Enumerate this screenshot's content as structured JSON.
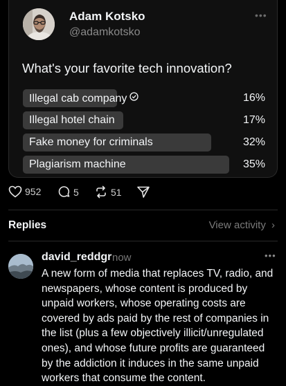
{
  "post": {
    "author_name": "Adam Kotsko",
    "author_handle": "@adamkotsko",
    "question": "What's your favorite tech innovation?",
    "poll": [
      {
        "label": "Illegal cab company",
        "percent_text": "16%",
        "percent": 16,
        "selected": true
      },
      {
        "label": "Illegal hotel chain",
        "percent_text": "17%",
        "percent": 17,
        "selected": false
      },
      {
        "label": "Fake money for criminals",
        "percent_text": "32%",
        "percent": 32,
        "selected": false
      },
      {
        "label": "Plagiarism machine",
        "percent_text": "35%",
        "percent": 35,
        "selected": false
      }
    ],
    "more_icon": "ellipsis-icon",
    "selected_icon": "check-circle-icon"
  },
  "actions": {
    "likes": "952",
    "comments": "5",
    "reposts": "51",
    "icons": [
      "heart-icon",
      "comment-icon",
      "repost-icon",
      "share-icon"
    ]
  },
  "replies_header": {
    "title": "Replies",
    "view_activity": "View activity",
    "chevron_icon": "chevron-right-icon"
  },
  "reply": {
    "username": "david_reddgr",
    "time": "now",
    "text": "A new form of media that replaces TV, radio, and newspapers, whose content is produced by unpaid workers, whose operating costs are covered by ads paid by the rest of companies in the list (plus a few objectively illicit/unregulated ones), and whose future profits are guaranteed by the addiction it induces in the same unpaid workers that consume the content."
  },
  "colors": {
    "background": "#000000",
    "card": "#101010",
    "poll_fill": "#3a3a3a",
    "text": "#f3f5f7",
    "muted": "#8a8a8a"
  }
}
